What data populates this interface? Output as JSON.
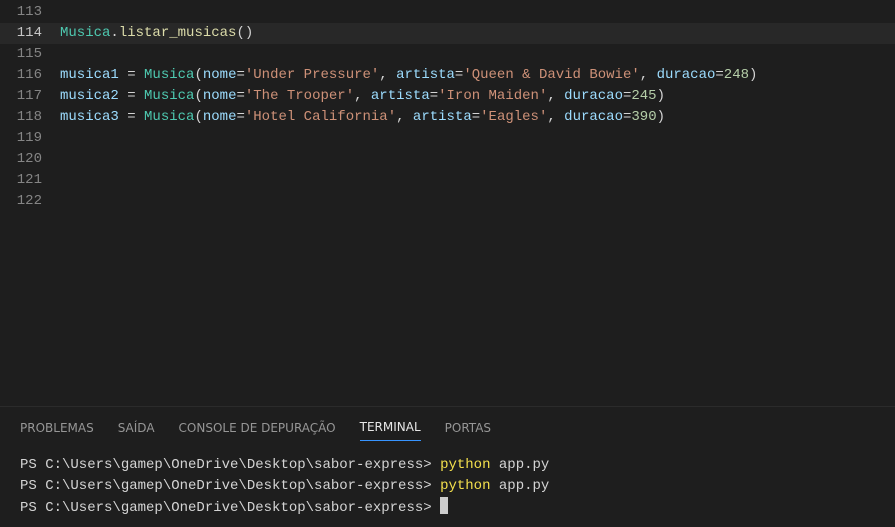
{
  "editor": {
    "lines": [
      {
        "num": "113",
        "tokens": []
      },
      {
        "num": "114",
        "highlight": true,
        "tokens": [
          {
            "t": "cls",
            "v": "Musica"
          },
          {
            "t": "punc",
            "v": "."
          },
          {
            "t": "fn",
            "v": "listar_musicas"
          },
          {
            "t": "punc",
            "v": "()"
          }
        ]
      },
      {
        "num": "115",
        "tokens": []
      },
      {
        "num": "116",
        "tokens": [
          {
            "t": "var",
            "v": "musica1"
          },
          {
            "t": "op",
            "v": " = "
          },
          {
            "t": "cls",
            "v": "Musica"
          },
          {
            "t": "punc",
            "v": "("
          },
          {
            "t": "param",
            "v": "nome"
          },
          {
            "t": "op",
            "v": "="
          },
          {
            "t": "str",
            "v": "'Under Pressure'"
          },
          {
            "t": "punc",
            "v": ", "
          },
          {
            "t": "param",
            "v": "artista"
          },
          {
            "t": "op",
            "v": "="
          },
          {
            "t": "str",
            "v": "'Queen & David Bowie'"
          },
          {
            "t": "punc",
            "v": ", "
          },
          {
            "t": "param",
            "v": "duracao"
          },
          {
            "t": "op",
            "v": "="
          },
          {
            "t": "num",
            "v": "248"
          },
          {
            "t": "punc",
            "v": ")"
          }
        ]
      },
      {
        "num": "117",
        "tokens": [
          {
            "t": "var",
            "v": "musica2"
          },
          {
            "t": "op",
            "v": " = "
          },
          {
            "t": "cls",
            "v": "Musica"
          },
          {
            "t": "punc",
            "v": "("
          },
          {
            "t": "param",
            "v": "nome"
          },
          {
            "t": "op",
            "v": "="
          },
          {
            "t": "str",
            "v": "'The Trooper'"
          },
          {
            "t": "punc",
            "v": ", "
          },
          {
            "t": "param",
            "v": "artista"
          },
          {
            "t": "op",
            "v": "="
          },
          {
            "t": "str",
            "v": "'Iron Maiden'"
          },
          {
            "t": "punc",
            "v": ", "
          },
          {
            "t": "param",
            "v": "duracao"
          },
          {
            "t": "op",
            "v": "="
          },
          {
            "t": "num",
            "v": "245"
          },
          {
            "t": "punc",
            "v": ")"
          }
        ]
      },
      {
        "num": "118",
        "tokens": [
          {
            "t": "var",
            "v": "musica3"
          },
          {
            "t": "op",
            "v": " = "
          },
          {
            "t": "cls",
            "v": "Musica"
          },
          {
            "t": "punc",
            "v": "("
          },
          {
            "t": "param",
            "v": "nome"
          },
          {
            "t": "op",
            "v": "="
          },
          {
            "t": "str",
            "v": "'Hotel California'"
          },
          {
            "t": "punc",
            "v": ", "
          },
          {
            "t": "param",
            "v": "artista"
          },
          {
            "t": "op",
            "v": "="
          },
          {
            "t": "str",
            "v": "'Eagles'"
          },
          {
            "t": "punc",
            "v": ", "
          },
          {
            "t": "param",
            "v": "duracao"
          },
          {
            "t": "op",
            "v": "="
          },
          {
            "t": "num",
            "v": "390"
          },
          {
            "t": "punc",
            "v": ")"
          }
        ]
      },
      {
        "num": "119",
        "tokens": []
      },
      {
        "num": "120",
        "tokens": []
      },
      {
        "num": "121",
        "tokens": []
      },
      {
        "num": "122",
        "tokens": []
      }
    ]
  },
  "panel": {
    "tabs": {
      "problemas": "PROBLEMAS",
      "saida": "SAÍDA",
      "debug": "CONSOLE DE DEPURAÇÃO",
      "terminal": "TERMINAL",
      "portas": "PORTAS"
    },
    "terminal": {
      "prompt": "PS C:\\Users\\gamep\\OneDrive\\Desktop\\sabor-express> ",
      "cmd": "python",
      "arg": " app.py"
    }
  }
}
